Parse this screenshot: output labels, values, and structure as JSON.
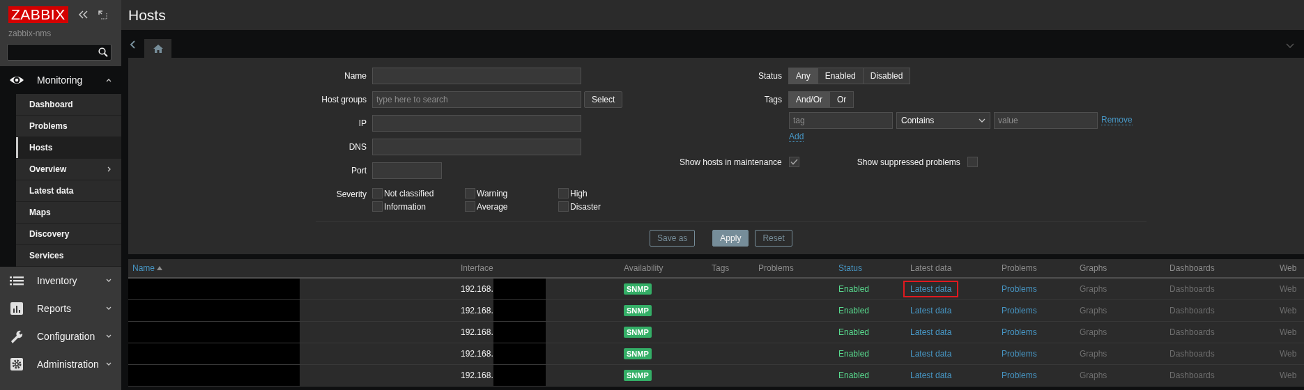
{
  "sidebar": {
    "logo": "ZABBIX",
    "server": "zabbix-nms",
    "menu": [
      {
        "label": "Monitoring",
        "expanded": true,
        "children": [
          {
            "label": "Dashboard",
            "selected": false,
            "has_submenu": false
          },
          {
            "label": "Problems",
            "selected": false,
            "has_submenu": false
          },
          {
            "label": "Hosts",
            "selected": true,
            "has_submenu": false
          },
          {
            "label": "Overview",
            "selected": false,
            "has_submenu": true
          },
          {
            "label": "Latest data",
            "selected": false,
            "has_submenu": false
          },
          {
            "label": "Maps",
            "selected": false,
            "has_submenu": false
          },
          {
            "label": "Discovery",
            "selected": false,
            "has_submenu": false
          },
          {
            "label": "Services",
            "selected": false,
            "has_submenu": false
          }
        ]
      },
      {
        "label": "Inventory",
        "expanded": false
      },
      {
        "label": "Reports",
        "expanded": false
      },
      {
        "label": "Configuration",
        "expanded": false
      },
      {
        "label": "Administration",
        "expanded": false
      }
    ]
  },
  "page": {
    "title": "Hosts"
  },
  "filter": {
    "fields": [
      {
        "label": "Name",
        "kind": "text"
      },
      {
        "label": "Host groups",
        "kind": "multiselect",
        "placeholder": "type here to search",
        "button": "Select"
      },
      {
        "label": "IP",
        "kind": "text"
      },
      {
        "label": "DNS",
        "kind": "text"
      },
      {
        "label": "Port",
        "kind": "short"
      }
    ],
    "severity": {
      "label": "Severity",
      "options": [
        {
          "label": "Not classified",
          "checked": false
        },
        {
          "label": "Warning",
          "checked": false
        },
        {
          "label": "High",
          "checked": false
        },
        {
          "label": "Information",
          "checked": false
        },
        {
          "label": "Average",
          "checked": false
        },
        {
          "label": "Disaster",
          "checked": false
        }
      ]
    },
    "status": {
      "label": "Status",
      "options": [
        {
          "label": "Any",
          "selected": true
        },
        {
          "label": "Enabled",
          "selected": false
        },
        {
          "label": "Disabled",
          "selected": false
        }
      ]
    },
    "tags": {
      "label": "Tags",
      "operators": [
        {
          "label": "And/Or",
          "selected": true
        },
        {
          "label": "Or",
          "selected": false
        }
      ],
      "rows": [
        {
          "tag_placeholder": "tag",
          "operator": "Contains",
          "value_placeholder": "value",
          "remove": "Remove"
        }
      ],
      "add": "Add"
    },
    "maintenance": {
      "label": "Show hosts in maintenance",
      "checked": true
    },
    "suppressed": {
      "label": "Show suppressed problems",
      "checked": false
    },
    "buttons": [
      {
        "label": "Save as",
        "kind": "secondary"
      },
      {
        "label": "Apply",
        "kind": "primary"
      },
      {
        "label": "Reset",
        "kind": "secondary"
      }
    ]
  },
  "table": {
    "columns": [
      {
        "label": "Name",
        "sortable": true,
        "sorted_ascending": true
      },
      {
        "label": "Interface",
        "sortable": false
      },
      {
        "label": "Availability",
        "sortable": false
      },
      {
        "label": "Tags",
        "sortable": false
      },
      {
        "label": "Problems",
        "sortable": false
      },
      {
        "label": "Status",
        "sortable": true
      },
      {
        "label": "Latest data",
        "sortable": false
      },
      {
        "label": "Problems",
        "sortable": false
      },
      {
        "label": "Graphs",
        "sortable": false
      },
      {
        "label": "Dashboards",
        "sortable": false
      },
      {
        "label": "Web",
        "sortable": false
      }
    ],
    "rows": [
      {
        "name_redacted": true,
        "interface": "192.168.",
        "interface_redacted": true,
        "availability": "SNMP",
        "status": "Enabled",
        "enabled": true,
        "links": [
          {
            "label": "Latest data",
            "disabled": false,
            "highlighted": true
          },
          {
            "label": "Problems",
            "disabled": false,
            "highlighted": false
          },
          {
            "label": "Graphs",
            "disabled": true,
            "highlighted": false
          },
          {
            "label": "Dashboards",
            "disabled": true,
            "highlighted": false
          },
          {
            "label": "Web",
            "disabled": true,
            "highlighted": false
          }
        ]
      },
      {
        "name_redacted": true,
        "interface": "192.168.",
        "interface_redacted": true,
        "availability": "SNMP",
        "status": "Enabled",
        "enabled": true,
        "links": [
          {
            "label": "Latest data",
            "disabled": false,
            "highlighted": false
          },
          {
            "label": "Problems",
            "disabled": false,
            "highlighted": false
          },
          {
            "label": "Graphs",
            "disabled": true,
            "highlighted": false
          },
          {
            "label": "Dashboards",
            "disabled": true,
            "highlighted": false
          },
          {
            "label": "Web",
            "disabled": true,
            "highlighted": false
          }
        ]
      },
      {
        "name_redacted": true,
        "interface": "192.168.",
        "interface_redacted": true,
        "availability": "SNMP",
        "status": "Enabled",
        "enabled": true,
        "links": [
          {
            "label": "Latest data",
            "disabled": false,
            "highlighted": false
          },
          {
            "label": "Problems",
            "disabled": false,
            "highlighted": false
          },
          {
            "label": "Graphs",
            "disabled": true,
            "highlighted": false
          },
          {
            "label": "Dashboards",
            "disabled": true,
            "highlighted": false
          },
          {
            "label": "Web",
            "disabled": true,
            "highlighted": false
          }
        ]
      },
      {
        "name_redacted": true,
        "interface": "192.168.",
        "interface_redacted": true,
        "availability": "SNMP",
        "status": "Enabled",
        "enabled": true,
        "links": [
          {
            "label": "Latest data",
            "disabled": false,
            "highlighted": false
          },
          {
            "label": "Problems",
            "disabled": false,
            "highlighted": false
          },
          {
            "label": "Graphs",
            "disabled": true,
            "highlighted": false
          },
          {
            "label": "Dashboards",
            "disabled": true,
            "highlighted": false
          },
          {
            "label": "Web",
            "disabled": true,
            "highlighted": false
          }
        ]
      },
      {
        "name_redacted": true,
        "interface": "192.168.",
        "interface_redacted": true,
        "availability": "SNMP",
        "status": "Enabled",
        "enabled": true,
        "links": [
          {
            "label": "Latest data",
            "disabled": false,
            "highlighted": false
          },
          {
            "label": "Problems",
            "disabled": false,
            "highlighted": false
          },
          {
            "label": "Graphs",
            "disabled": true,
            "highlighted": false
          },
          {
            "label": "Dashboards",
            "disabled": true,
            "highlighted": false
          },
          {
            "label": "Web",
            "disabled": true,
            "highlighted": false
          }
        ]
      }
    ]
  }
}
